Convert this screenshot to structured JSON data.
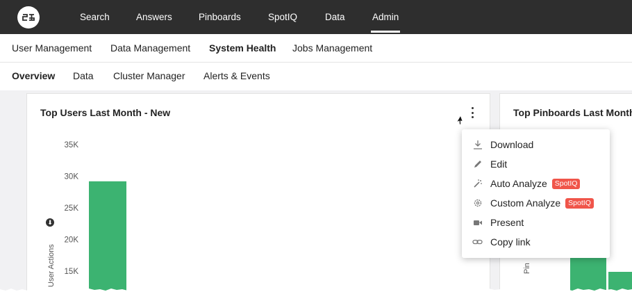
{
  "app": {
    "logo_icon": "thoughtspot-logo-icon"
  },
  "topnav": {
    "items": [
      {
        "label": "Search"
      },
      {
        "label": "Answers"
      },
      {
        "label": "Pinboards"
      },
      {
        "label": "SpotIQ"
      },
      {
        "label": "Data"
      },
      {
        "label": "Admin",
        "active": true
      }
    ]
  },
  "subnav": {
    "items": [
      {
        "label": "User Management"
      },
      {
        "label": "Data Management"
      },
      {
        "label": "System Health",
        "active": true
      },
      {
        "label": "Jobs Management"
      }
    ]
  },
  "tabs": {
    "items": [
      {
        "label": "Overview",
        "active": true
      },
      {
        "label": "Data"
      },
      {
        "label": "Cluster Manager"
      },
      {
        "label": "Alerts & Events"
      }
    ]
  },
  "cards": {
    "left": {
      "title": "Top Users Last Month - New",
      "menu_icon": "kebab-menu-icon"
    },
    "right": {
      "title": "Top Pinboards Last Month",
      "yaxis_partial": "Pin"
    }
  },
  "menu": {
    "items": [
      {
        "label": "Download",
        "icon": "download-icon"
      },
      {
        "label": "Edit",
        "icon": "pencil-icon"
      },
      {
        "label": "Auto Analyze",
        "icon": "magic-wand-icon",
        "badge": "SpotIQ"
      },
      {
        "label": "Custom Analyze",
        "icon": "gear-icon",
        "badge": "SpotIQ"
      },
      {
        "label": "Present",
        "icon": "video-camera-icon"
      },
      {
        "label": "Copy link",
        "icon": "link-icon"
      }
    ]
  },
  "colors": {
    "nav_bg": "#2e2e2e",
    "bar": "#3cb371",
    "badge": "#f0554a",
    "content_bg": "#f1f1f3"
  },
  "chart_data": [
    {
      "type": "bar",
      "title": "Top Users Last Month - New",
      "ylabel": "User Actions",
      "yticks": [
        "35K",
        "30K",
        "25K",
        "20K",
        "15K"
      ],
      "ylim": [
        0,
        35000
      ],
      "categories": [
        ""
      ],
      "values": [
        29200
      ]
    },
    {
      "type": "bar",
      "title": "Top Pinboards Last Month",
      "ylabel": "Pin",
      "categories": [
        "",
        ""
      ],
      "values": [
        null,
        null
      ]
    }
  ]
}
